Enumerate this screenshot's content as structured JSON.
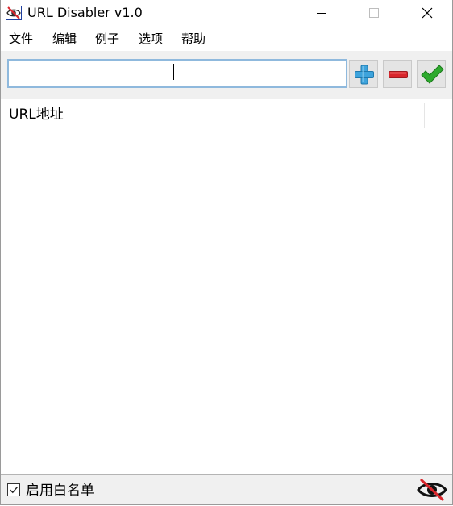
{
  "window": {
    "title": "URL Disabler v1.0"
  },
  "menu": {
    "items": [
      "文件",
      "编辑",
      "例子",
      "选项",
      "帮助"
    ]
  },
  "toolbar": {
    "url_value": "",
    "add_icon": "plus-icon",
    "remove_icon": "minus-icon",
    "apply_icon": "checkmark-icon"
  },
  "list": {
    "column_header": "URL地址",
    "rows": []
  },
  "statusbar": {
    "whitelist_label": "启用白名单",
    "whitelist_checked": true,
    "status_icon": "eye-disabled-icon"
  },
  "colors": {
    "add": "#3da3dc",
    "remove": "#d9262c",
    "apply": "#2eaa2e",
    "input_border": "#8fb9dd",
    "toolbar_bg": "#f0f0f0"
  }
}
